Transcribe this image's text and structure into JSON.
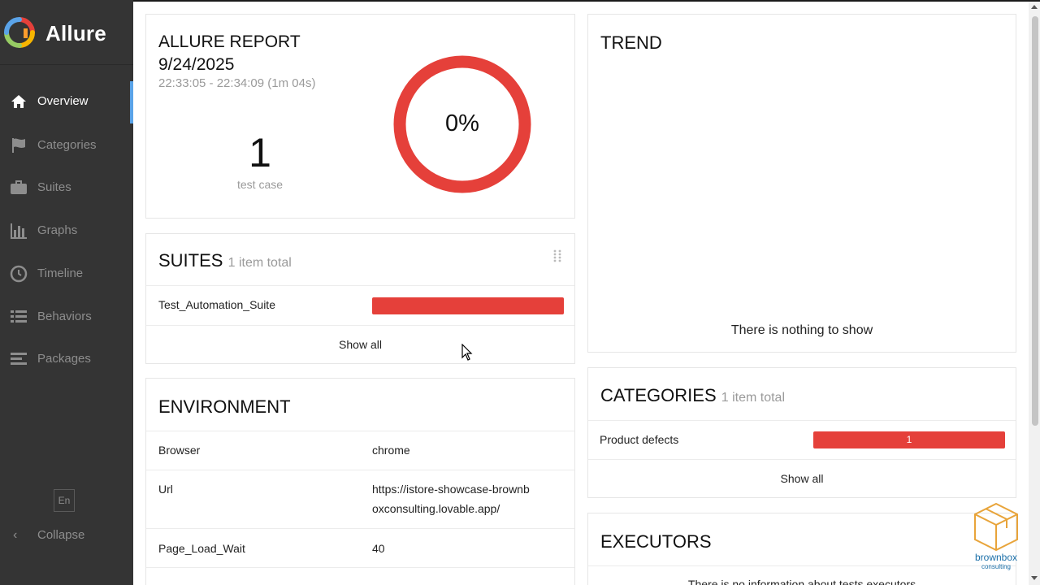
{
  "app": {
    "brand": "Allure"
  },
  "sidebar": {
    "items": [
      {
        "label": "Overview",
        "icon": "home-icon",
        "active": true
      },
      {
        "label": "Categories",
        "icon": "flag-icon",
        "active": false
      },
      {
        "label": "Suites",
        "icon": "briefcase-icon",
        "active": false
      },
      {
        "label": "Graphs",
        "icon": "bar-chart-icon",
        "active": false
      },
      {
        "label": "Timeline",
        "icon": "clock-icon",
        "active": false
      },
      {
        "label": "Behaviors",
        "icon": "list-icon",
        "active": false
      },
      {
        "label": "Packages",
        "icon": "align-left-icon",
        "active": false
      }
    ],
    "language": "En",
    "collapse_label": "Collapse"
  },
  "summary": {
    "title": "ALLURE REPORT",
    "date": "9/24/2025",
    "time_range": "22:33:05 - 22:34:09 (1m 04s)",
    "test_count": "1",
    "test_count_label": "test case",
    "percent": "0%",
    "failed_fraction": 1.0,
    "colors": {
      "failed": "#e5403a",
      "passed": "#97cc64"
    }
  },
  "suites": {
    "title": "SUITES",
    "subtitle": "1 item total",
    "items": [
      {
        "name": "Test_Automation_Suite",
        "failed_fraction": 1.0
      }
    ],
    "show_all": "Show all"
  },
  "environment": {
    "title": "ENVIRONMENT",
    "rows": [
      {
        "key": "Browser",
        "value": "chrome"
      },
      {
        "key": "Url",
        "value": "https://istore-showcase-brownboxconsulting.lovable.app/"
      },
      {
        "key": "Page_Load_Wait",
        "value": "40"
      }
    ]
  },
  "trend": {
    "title": "TREND",
    "empty_text": "There is nothing to show"
  },
  "categories": {
    "title": "CATEGORIES",
    "subtitle": "1 item total",
    "items": [
      {
        "name": "Product defects",
        "count": "1"
      }
    ],
    "show_all": "Show all"
  },
  "executors": {
    "title": "EXECUTORS",
    "empty_text": "There is no information about tests executors"
  },
  "watermark": {
    "name": "brownbox",
    "sub": "consulting"
  }
}
